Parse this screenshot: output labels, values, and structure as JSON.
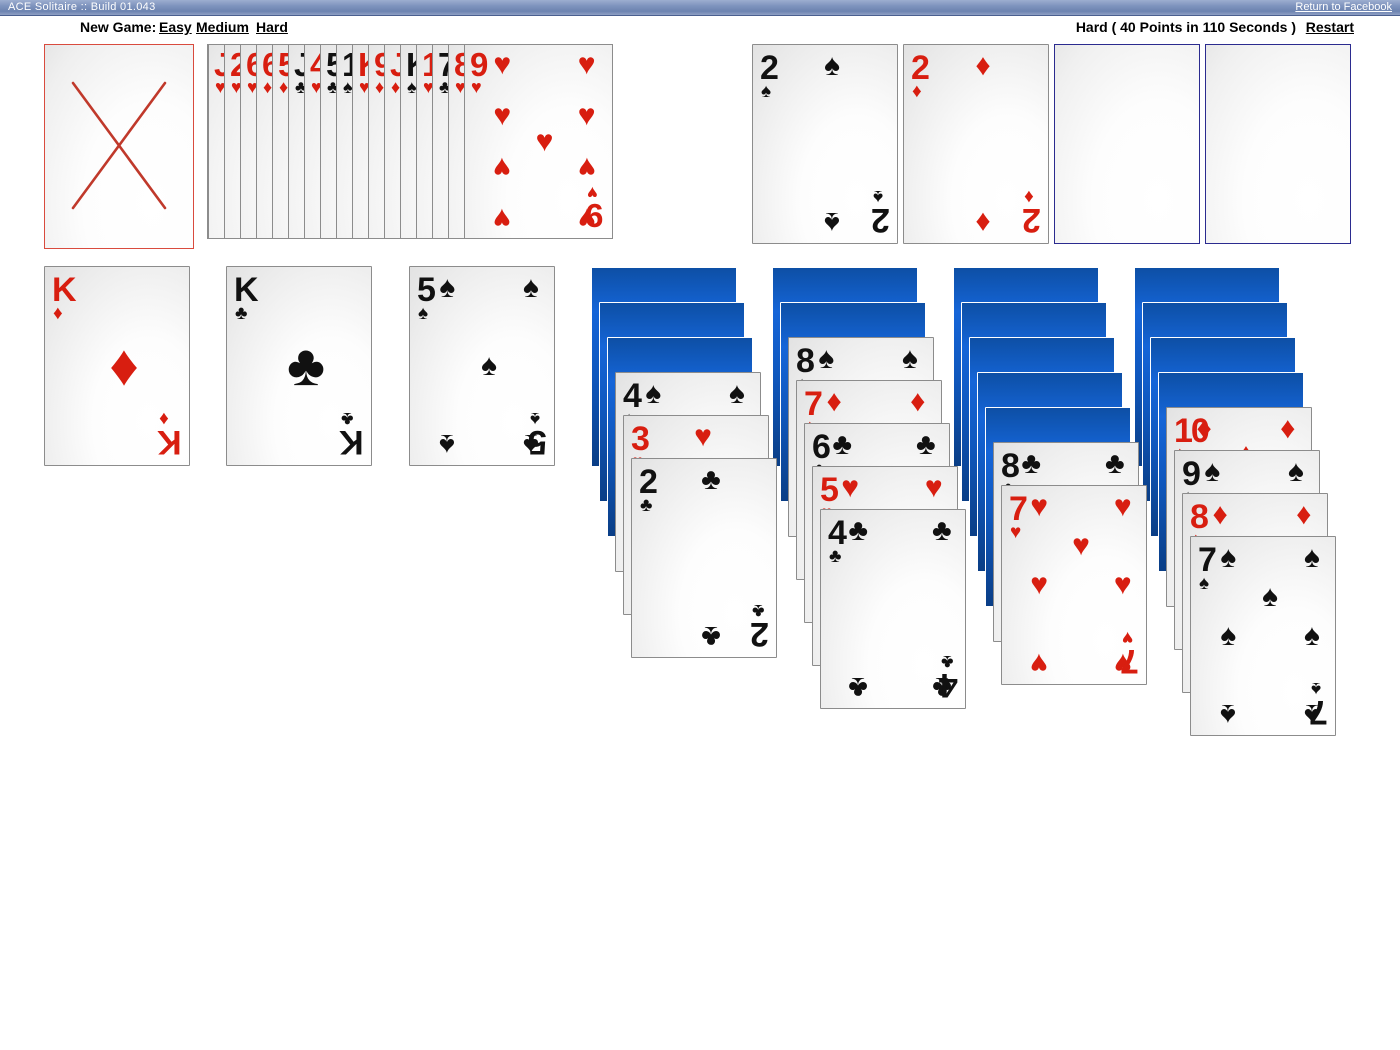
{
  "window": {
    "title": "ACE Solitaire :: Build 01.043",
    "return_link": "Return to Facebook"
  },
  "toolbar": {
    "new_game_label": "New Game:",
    "easy": "Easy",
    "medium": "Medium",
    "hard": "Hard",
    "status": "Hard ( 40 Points in 110 Seconds )",
    "restart": "Restart"
  },
  "suits": {
    "spade": "♠",
    "heart": "♥",
    "diamond": "♦",
    "club": "♣"
  },
  "colors": {
    "red": "#d81e10",
    "black": "#111111",
    "card_back": "#0f57bd",
    "empty_slot_border": "#2b2b8f",
    "stock_border": "#d94b3e",
    "titlebar": "#7e93bd"
  },
  "stock": {
    "name": "stock-pile",
    "state": "empty",
    "marker": "red-x"
  },
  "waste": {
    "name": "waste-pile",
    "count": 17,
    "cards": [
      {
        "rank": "J",
        "suit": "heart",
        "color": "red"
      },
      {
        "rank": "2",
        "suit": "heart",
        "color": "red"
      },
      {
        "rank": "6",
        "suit": "heart",
        "color": "red"
      },
      {
        "rank": "6",
        "suit": "diamond",
        "color": "red"
      },
      {
        "rank": "5",
        "suit": "diamond",
        "color": "red"
      },
      {
        "rank": "J",
        "suit": "club",
        "color": "black"
      },
      {
        "rank": "4",
        "suit": "heart",
        "color": "red"
      },
      {
        "rank": "5",
        "suit": "club",
        "color": "black"
      },
      {
        "rank": "10",
        "suit": "spade",
        "color": "black"
      },
      {
        "rank": "K",
        "suit": "heart",
        "color": "red"
      },
      {
        "rank": "9",
        "suit": "diamond",
        "color": "red"
      },
      {
        "rank": "J",
        "suit": "diamond",
        "color": "red"
      },
      {
        "rank": "K",
        "suit": "spade",
        "color": "black"
      },
      {
        "rank": "10",
        "suit": "heart",
        "color": "red"
      },
      {
        "rank": "7",
        "suit": "club",
        "color": "black"
      },
      {
        "rank": "8",
        "suit": "heart",
        "color": "red"
      },
      {
        "rank": "9",
        "suit": "heart",
        "color": "red"
      }
    ],
    "top_card": {
      "rank": "9",
      "suit": "heart",
      "color": "red"
    }
  },
  "foundations": [
    {
      "name": "foundation-1",
      "state": "filled",
      "rank": "2",
      "suit": "spade",
      "color": "black"
    },
    {
      "name": "foundation-2",
      "state": "filled",
      "rank": "2",
      "suit": "diamond",
      "color": "red"
    },
    {
      "name": "foundation-3",
      "state": "empty"
    },
    {
      "name": "foundation-4",
      "state": "empty"
    }
  ],
  "freecells": [
    {
      "name": "freecell-1",
      "state": "filled",
      "rank": "K",
      "suit": "diamond",
      "color": "red"
    },
    {
      "name": "freecell-2",
      "state": "filled",
      "rank": "K",
      "suit": "club",
      "color": "black"
    },
    {
      "name": "freecell-3",
      "state": "filled",
      "rank": "5",
      "suit": "spade",
      "color": "black"
    }
  ],
  "tableau": [
    {
      "name": "tableau-column-1",
      "facedown": 3,
      "faceup": [
        {
          "rank": "4",
          "suit": "spade",
          "color": "black"
        },
        {
          "rank": "3",
          "suit": "heart",
          "color": "red"
        },
        {
          "rank": "2",
          "suit": "club",
          "color": "black"
        }
      ]
    },
    {
      "name": "tableau-column-2",
      "facedown": 2,
      "faceup": [
        {
          "rank": "8",
          "suit": "spade",
          "color": "black"
        },
        {
          "rank": "7",
          "suit": "diamond",
          "color": "red"
        },
        {
          "rank": "6",
          "suit": "club",
          "color": "black"
        },
        {
          "rank": "5",
          "suit": "heart",
          "color": "red"
        },
        {
          "rank": "4",
          "suit": "club",
          "color": "black"
        }
      ]
    },
    {
      "name": "tableau-column-3",
      "facedown": 5,
      "faceup": [
        {
          "rank": "8",
          "suit": "club",
          "color": "black"
        },
        {
          "rank": "7",
          "suit": "heart",
          "color": "red"
        }
      ]
    },
    {
      "name": "tableau-column-4",
      "facedown": 4,
      "faceup": [
        {
          "rank": "10",
          "suit": "diamond",
          "color": "red"
        },
        {
          "rank": "9",
          "suit": "spade",
          "color": "black"
        },
        {
          "rank": "8",
          "suit": "diamond",
          "color": "red"
        },
        {
          "rank": "7",
          "suit": "spade",
          "color": "black"
        }
      ]
    }
  ]
}
